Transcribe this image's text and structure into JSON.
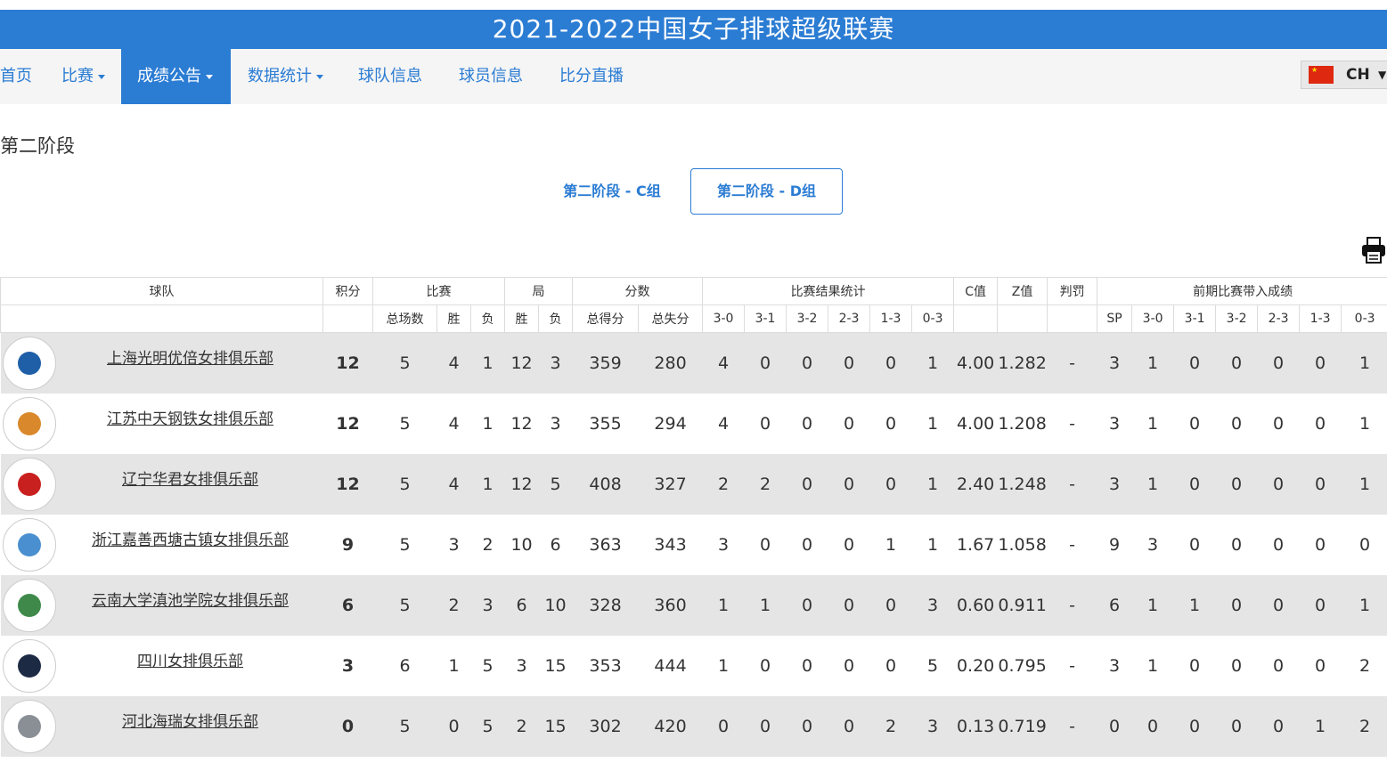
{
  "page": {
    "title": "2021-2022中国女子排球超级联赛"
  },
  "nav": {
    "items": [
      {
        "label": "首页",
        "dropdown": false,
        "active": false
      },
      {
        "label": "比赛",
        "dropdown": true,
        "active": false
      },
      {
        "label": "成绩公告",
        "dropdown": true,
        "active": true
      },
      {
        "label": "数据统计",
        "dropdown": true,
        "active": false
      },
      {
        "label": "球队信息",
        "dropdown": false,
        "active": false
      },
      {
        "label": "球员信息",
        "dropdown": false,
        "active": false
      },
      {
        "label": "比分直播",
        "dropdown": false,
        "active": false
      }
    ],
    "language": {
      "code": "CH",
      "flag_icon": "china-flag-icon"
    }
  },
  "stage": {
    "title": "第二阶段",
    "tabs": [
      {
        "label": "第二阶段 - C组",
        "active": false
      },
      {
        "label": "第二阶段 - D组",
        "active": true
      }
    ]
  },
  "table": {
    "group_headers": {
      "team": "球队",
      "points": "积分",
      "matches": "比赛",
      "sets": "局",
      "score": "分数",
      "results": "比赛结果统计",
      "c_value": "C值",
      "z_value": "Z值",
      "penalty": "判罚",
      "carry": "前期比赛带入成绩"
    },
    "sub_headers": {
      "matches_total": "总场数",
      "matches_won": "胜",
      "matches_lost": "负",
      "sets_won": "胜",
      "sets_lost": "负",
      "points_for": "总得分",
      "points_against": "总失分",
      "results": [
        "3-0",
        "3-1",
        "3-2",
        "2-3",
        "1-3",
        "0-3"
      ],
      "carry": [
        "SP",
        "3-0",
        "3-1",
        "3-2",
        "2-3",
        "1-3",
        "0-3"
      ]
    },
    "rows": [
      {
        "team": "上海光明优倍女排俱乐部",
        "logo_color": "#1f5fa8",
        "points": "12",
        "played": "5",
        "won": "4",
        "lost": "1",
        "sets_won": "12",
        "sets_lost": "3",
        "pts_for": "359",
        "pts_against": "280",
        "results": [
          "4",
          "0",
          "0",
          "0",
          "0",
          "1"
        ],
        "c": "4.00",
        "z": "1.282",
        "penalty": "-",
        "carry": [
          "3",
          "1",
          "0",
          "0",
          "0",
          "0",
          "1"
        ]
      },
      {
        "team": "江苏中天钢铁女排俱乐部",
        "logo_color": "#d9892b",
        "points": "12",
        "played": "5",
        "won": "4",
        "lost": "1",
        "sets_won": "12",
        "sets_lost": "3",
        "pts_for": "355",
        "pts_against": "294",
        "results": [
          "4",
          "0",
          "0",
          "0",
          "0",
          "1"
        ],
        "c": "4.00",
        "z": "1.208",
        "penalty": "-",
        "carry": [
          "3",
          "1",
          "0",
          "0",
          "0",
          "0",
          "1"
        ]
      },
      {
        "team": "辽宁华君女排俱乐部",
        "logo_color": "#c8201e",
        "points": "12",
        "played": "5",
        "won": "4",
        "lost": "1",
        "sets_won": "12",
        "sets_lost": "5",
        "pts_for": "408",
        "pts_against": "327",
        "results": [
          "2",
          "2",
          "0",
          "0",
          "0",
          "1"
        ],
        "c": "2.40",
        "z": "1.248",
        "penalty": "-",
        "carry": [
          "3",
          "1",
          "0",
          "0",
          "0",
          "0",
          "1"
        ]
      },
      {
        "team": "浙江嘉善西塘古镇女排俱乐部",
        "logo_color": "#4a8fcf",
        "points": "9",
        "played": "5",
        "won": "3",
        "lost": "2",
        "sets_won": "10",
        "sets_lost": "6",
        "pts_for": "363",
        "pts_against": "343",
        "results": [
          "3",
          "0",
          "0",
          "0",
          "1",
          "1"
        ],
        "c": "1.67",
        "z": "1.058",
        "penalty": "-",
        "carry": [
          "9",
          "3",
          "0",
          "0",
          "0",
          "0",
          "0"
        ]
      },
      {
        "team": "云南大学滇池学院女排俱乐部",
        "logo_color": "#3f8a4a",
        "points": "6",
        "played": "5",
        "won": "2",
        "lost": "3",
        "sets_won": "6",
        "sets_lost": "10",
        "pts_for": "328",
        "pts_against": "360",
        "results": [
          "1",
          "1",
          "0",
          "0",
          "0",
          "3"
        ],
        "c": "0.60",
        "z": "0.911",
        "penalty": "-",
        "carry": [
          "6",
          "1",
          "1",
          "0",
          "0",
          "0",
          "1"
        ]
      },
      {
        "team": "四川女排俱乐部",
        "logo_color": "#1d2a44",
        "points": "3",
        "played": "6",
        "won": "1",
        "lost": "5",
        "sets_won": "3",
        "sets_lost": "15",
        "pts_for": "353",
        "pts_against": "444",
        "results": [
          "1",
          "0",
          "0",
          "0",
          "0",
          "5"
        ],
        "c": "0.20",
        "z": "0.795",
        "penalty": "-",
        "carry": [
          "3",
          "1",
          "0",
          "0",
          "0",
          "0",
          "2"
        ]
      },
      {
        "team": "河北海瑞女排俱乐部",
        "logo_color": "#8a8f96",
        "points": "0",
        "played": "5",
        "won": "0",
        "lost": "5",
        "sets_won": "2",
        "sets_lost": "15",
        "pts_for": "302",
        "pts_against": "420",
        "results": [
          "0",
          "0",
          "0",
          "0",
          "2",
          "3"
        ],
        "c": "0.13",
        "z": "0.719",
        "penalty": "-",
        "carry": [
          "0",
          "0",
          "0",
          "0",
          "0",
          "1",
          "2"
        ]
      }
    ]
  },
  "icons": {
    "print": "print-icon",
    "caret": "caret-down-icon"
  },
  "colors": {
    "accent": "#2b7cd3",
    "row_alt": "#e5e5e5"
  }
}
